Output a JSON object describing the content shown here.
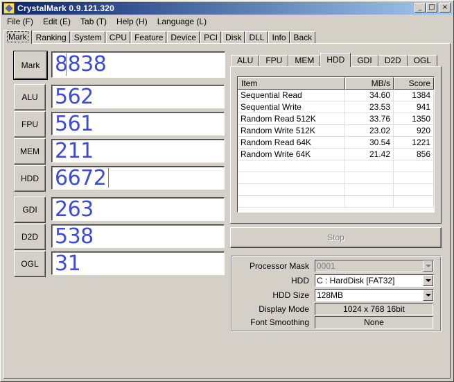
{
  "window": {
    "title": "CrystalMark  0.9.121.320"
  },
  "title_buttons": {
    "minimize": "_",
    "maximize": "□",
    "close": "×"
  },
  "menu": [
    "File (F)",
    "Edit (E)",
    "Tab (T)",
    "Help (H)",
    "Language (L)"
  ],
  "main_tabs": [
    "Mark",
    "Ranking",
    "System",
    "CPU",
    "Feature",
    "Device",
    "PCI",
    "Disk",
    "DLL",
    "Info",
    "Back"
  ],
  "scores": {
    "mark": {
      "label": "Mark",
      "value": "8838"
    },
    "alu": {
      "label": "ALU",
      "value": "562"
    },
    "fpu": {
      "label": "FPU",
      "value": "561"
    },
    "mem": {
      "label": "MEM",
      "value": "211"
    },
    "hdd": {
      "label": "HDD",
      "value": "6672"
    },
    "gdi": {
      "label": "GDI",
      "value": "263"
    },
    "d2d": {
      "label": "D2D",
      "value": "538"
    },
    "ogl": {
      "label": "OGL",
      "value": "31"
    }
  },
  "sub_tabs": [
    "ALU",
    "FPU",
    "MEM",
    "HDD",
    "GDI",
    "D2D",
    "OGL"
  ],
  "table": {
    "headers": [
      "Item",
      "MB/s",
      "Score"
    ],
    "rows": [
      [
        "Sequential Read",
        "34.60",
        "1384"
      ],
      [
        "Sequential Write",
        "23.53",
        "941"
      ],
      [
        "Random Read 512K",
        "33.76",
        "1350"
      ],
      [
        "Random Write 512K",
        "23.02",
        "920"
      ],
      [
        "Random Read 64K",
        "30.54",
        "1221"
      ],
      [
        "Random Write 64K",
        "21.42",
        "856"
      ]
    ]
  },
  "stop_label": "Stop",
  "settings": {
    "processor_mask": {
      "label": "Processor Mask",
      "value": "0001"
    },
    "hdd": {
      "label": "HDD",
      "value": "C : HardDisk [FAT32]"
    },
    "hdd_size": {
      "label": "HDD Size",
      "value": "128MB"
    },
    "display_mode": {
      "label": "Display Mode",
      "value": "1024 x 768 16bit"
    },
    "font_smoothing": {
      "label": "Font Smoothing",
      "value": "None"
    }
  },
  "colors": {
    "score_text": "#3d4bd6",
    "title_start": "#0a246a",
    "title_end": "#a6caf0",
    "face": "#d4d0c8"
  }
}
